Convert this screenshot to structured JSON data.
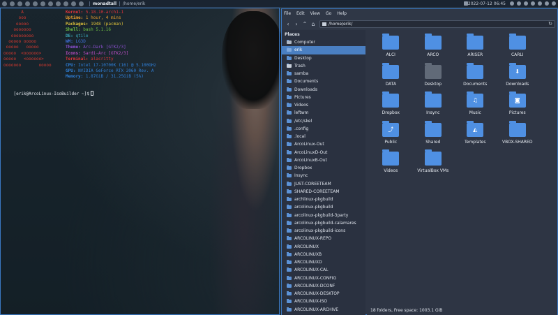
{
  "topbar": {
    "layout": "monadtall",
    "window_title": "/home/erik",
    "clock": "2022-07-12 06:45"
  },
  "terminal": {
    "logo_lines": [
      "       A",
      "      ooo",
      "     ooooo",
      "    ooooooo",
      "   ooooooooo",
      "  ooooo ooooo",
      " ooooo   ooooo",
      "ooooo  <oooooo>",
      "ooooo   <oooooo>",
      "ooooooo       ooooo"
    ],
    "info": [
      {
        "key": "Kernel:",
        "value": " 5.18.10-arch1-1"
      },
      {
        "key": "Uptime:",
        "value": " 1 hour, 4 mins"
      },
      {
        "key": "Packages:",
        "value": " 1948 (pacman)"
      },
      {
        "key": "Shell:",
        "value": " bash 5.1.16"
      },
      {
        "key": "DE:",
        "value": " qtile"
      },
      {
        "key": "WM:",
        "value": " LG3D"
      },
      {
        "key": "Theme:",
        "value": " Arc-Dark [GTK2/3]"
      },
      {
        "key": "Icons:",
        "value": " Sardi-Arc [GTK2/3]"
      },
      {
        "key": "Terminal:",
        "value": " alacritty"
      },
      {
        "key": "CPU:",
        "value": " Intel i7-10700K (16) @ 5.100GHz"
      },
      {
        "key": "GPU:",
        "value": " NVIDIA GeForce RTX 2060 Rev. A"
      },
      {
        "key": "Memory:",
        "value": " 1.87GiB / 31.25GiB (5%)"
      }
    ],
    "info_colors": [
      "#e0333a",
      "#e89b2d",
      "#e0c33a",
      "#6fbf42",
      "#3aa7b8",
      "#3f6fd8",
      "#8b4fd0",
      "#c14fc9",
      "#e0333a",
      "#2f7fd8",
      "#2f7fd8",
      "#2f7fd8"
    ],
    "prompt": "[erik@ArcoLinux-IsoBuilder ~]$"
  },
  "filemanager": {
    "menu": [
      "File",
      "Edit",
      "View",
      "Go",
      "Help"
    ],
    "path": "/home/erik/",
    "places_header": "Places",
    "sidebar": [
      {
        "label": "Computer",
        "icon": "drive"
      },
      {
        "label": "erik",
        "icon": "home",
        "active": true
      },
      {
        "label": "Desktop",
        "icon": "folder"
      },
      {
        "label": "Trash",
        "icon": "trash"
      },
      {
        "label": "samba",
        "icon": "folder"
      },
      {
        "label": "Documents",
        "icon": "folder"
      },
      {
        "label": "Downloads",
        "icon": "folder"
      },
      {
        "label": "Pictures",
        "icon": "folder"
      },
      {
        "label": "Videos",
        "icon": "folder"
      },
      {
        "label": "leftwm",
        "icon": "folder"
      },
      {
        "label": "/etc/skel",
        "icon": "folder"
      },
      {
        "label": ".config",
        "icon": "folder"
      },
      {
        "label": ".local",
        "icon": "folder"
      },
      {
        "label": "ArcoLinux-Out",
        "icon": "folder"
      },
      {
        "label": "ArcoLinuxD-Out",
        "icon": "folder"
      },
      {
        "label": "ArcoLinuxB-Out",
        "icon": "folder"
      },
      {
        "label": "Dropbox",
        "icon": "folder"
      },
      {
        "label": "Insync",
        "icon": "folder"
      },
      {
        "label": "JUST-COREETEAM",
        "icon": "folder"
      },
      {
        "label": "SHARED-COREETEAM",
        "icon": "folder"
      },
      {
        "label": "archlinux-pkgbuild",
        "icon": "folder"
      },
      {
        "label": "arcolinux-pkgbuild",
        "icon": "folder"
      },
      {
        "label": "arcolinux-pkgbuild-3party",
        "icon": "folder"
      },
      {
        "label": "arcolinux-pkgbuild-calamares",
        "icon": "folder"
      },
      {
        "label": "arcolinux-pkgbuild-icons",
        "icon": "folder"
      },
      {
        "label": "ARCOLINUX-REPO",
        "icon": "folder"
      },
      {
        "label": "ARCOLINUX",
        "icon": "folder"
      },
      {
        "label": "ARCOLINUXB",
        "icon": "folder"
      },
      {
        "label": "ARCOLINUXD",
        "icon": "folder"
      },
      {
        "label": "ARCOLINUX-CAL",
        "icon": "folder"
      },
      {
        "label": "ARCOLINUX-CONFIG",
        "icon": "folder"
      },
      {
        "label": "ARCOLINUX-DCONF",
        "icon": "folder"
      },
      {
        "label": "ARCOLINUX-DESKTOP",
        "icon": "folder"
      },
      {
        "label": "ARCOLINUX-ISO",
        "icon": "folder"
      },
      {
        "label": "ARCOLINUX-ARCHIVE",
        "icon": "folder"
      }
    ],
    "folders": [
      {
        "label": "ALCI",
        "emblem": "",
        "kind": "folder"
      },
      {
        "label": "ARCO",
        "emblem": "",
        "kind": "folder"
      },
      {
        "label": "ARISER",
        "emblem": "",
        "kind": "folder"
      },
      {
        "label": "CARLI",
        "emblem": "",
        "kind": "folder"
      },
      {
        "label": "DATA",
        "emblem": "",
        "kind": "folder"
      },
      {
        "label": "Desktop",
        "emblem": "",
        "kind": "desktop"
      },
      {
        "label": "Documents",
        "emblem": "",
        "kind": "folder"
      },
      {
        "label": "Downloads",
        "emblem": "⬇",
        "kind": "folder"
      },
      {
        "label": "Dropbox",
        "emblem": "",
        "kind": "folder"
      },
      {
        "label": "Insync",
        "emblem": "",
        "kind": "folder"
      },
      {
        "label": "Music",
        "emblem": "♫",
        "kind": "folder"
      },
      {
        "label": "Pictures",
        "emblem": "◙",
        "kind": "folder"
      },
      {
        "label": "Public",
        "emblem": "⤴",
        "kind": "folder"
      },
      {
        "label": "Shared",
        "emblem": "",
        "kind": "folder"
      },
      {
        "label": "Templates",
        "emblem": "◭",
        "kind": "folder"
      },
      {
        "label": "VBOX-SHARED",
        "emblem": "",
        "kind": "folder"
      },
      {
        "label": "Videos",
        "emblem": "",
        "kind": "folder"
      },
      {
        "label": "VirtualBox VMs",
        "emblem": "",
        "kind": "folder"
      }
    ],
    "status": "18 folders, Free space: 1003.1 GiB"
  }
}
